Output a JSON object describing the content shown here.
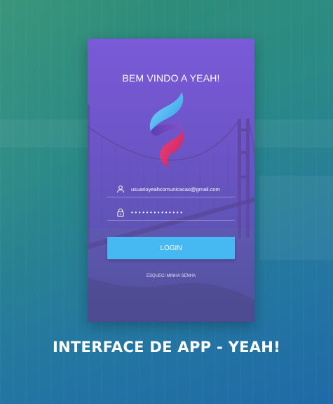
{
  "app": {
    "welcome_title": "BEM VINDO A YEAH!",
    "email_value": "usuarioyeahcomunicacao@gmail.com",
    "password_mask": "••••••••••••••",
    "login_label": "LOGIN",
    "forgot_label": "ESQUECI MINHA SENHA"
  },
  "caption": {
    "text": "INTERFACE DE APP - YEAH!"
  },
  "colors": {
    "button": "#47b9f2",
    "panel_top": "#7a5ad8",
    "panel_bottom": "#4a4a9c",
    "logo_blue": "#3fb3ef",
    "logo_pink": "#e8336b",
    "logo_purple": "#6b3fb4"
  },
  "icons": {
    "email": "user-icon",
    "password": "lock-icon",
    "logo": "yeah-logo-icon"
  }
}
